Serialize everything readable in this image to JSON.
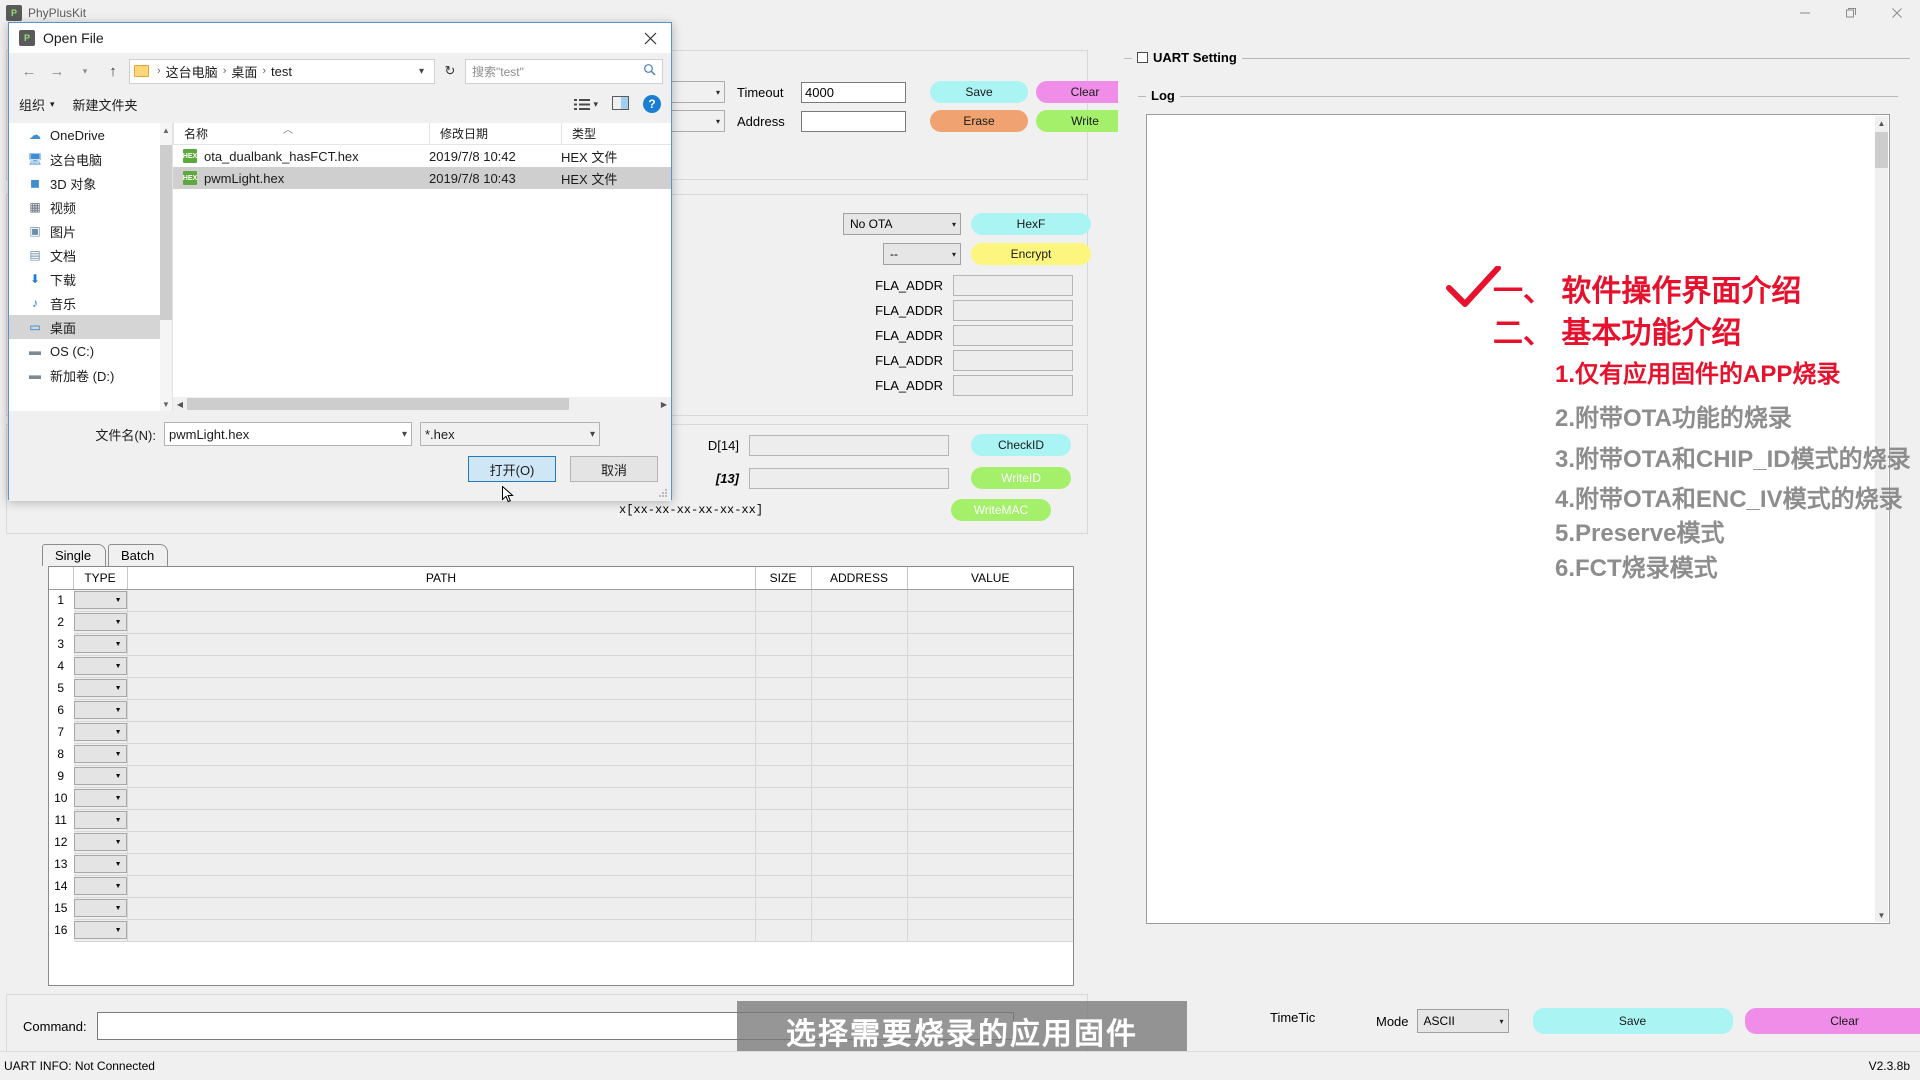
{
  "app": {
    "title": "PhyPlusKit",
    "version": "V2.3.8b",
    "window_controls": {
      "minimize": "minimize-icon",
      "maximize": "maximize-icon",
      "close": "close-icon"
    }
  },
  "config": {
    "timeout_label": "Timeout",
    "timeout_value": "4000",
    "address_label": "Address",
    "address_value": "",
    "buttons": {
      "save": "Save",
      "clear": "Clear",
      "erase": "Erase",
      "write": "Write"
    },
    "colors": {
      "save": "#aaf4f4",
      "clear": "#ef8de8",
      "erase": "#f0a271",
      "write": "#a4f06b"
    }
  },
  "ota": {
    "mode_value": "No OTA",
    "sub_value": "--",
    "hexf_label": "HexF",
    "encrypt_label": "Encrypt",
    "fla_label": "FLA_ADDR",
    "fla_rows": [
      "",
      "",
      "",
      "",
      ""
    ],
    "colors": {
      "hexf": "#aaf4f4",
      "encrypt": "#fcf67e"
    }
  },
  "idmac": {
    "chipid_label": "D[14]",
    "chipid_value": "",
    "mac_label": "[13]",
    "mac_value": "",
    "mac_hint": "x[xx-xx-xx-xx-xx-xx]",
    "checkid_label": "CheckID",
    "writeid_label": "WriteID",
    "writemac_label": "WriteMAC",
    "colors": {
      "checkid": "#aaf4f4",
      "writeid": "#a4f06b",
      "writemac": "#a4f06b"
    }
  },
  "tabs": [
    {
      "label": "Single",
      "active": true
    },
    {
      "label": "Batch",
      "active": false
    }
  ],
  "table": {
    "columns": [
      "",
      "TYPE",
      "PATH",
      "SIZE",
      "ADDRESS",
      "VALUE"
    ],
    "rows": [
      {
        "n": "1",
        "type": "",
        "path": "",
        "size": "",
        "address": "",
        "value": ""
      },
      {
        "n": "2",
        "type": "",
        "path": "",
        "size": "",
        "address": "",
        "value": ""
      },
      {
        "n": "3",
        "type": "",
        "path": "",
        "size": "",
        "address": "",
        "value": ""
      },
      {
        "n": "4",
        "type": "",
        "path": "",
        "size": "",
        "address": "",
        "value": ""
      },
      {
        "n": "5",
        "type": "",
        "path": "",
        "size": "",
        "address": "",
        "value": ""
      },
      {
        "n": "6",
        "type": "",
        "path": "",
        "size": "",
        "address": "",
        "value": ""
      },
      {
        "n": "7",
        "type": "",
        "path": "",
        "size": "",
        "address": "",
        "value": ""
      },
      {
        "n": "8",
        "type": "",
        "path": "",
        "size": "",
        "address": "",
        "value": ""
      },
      {
        "n": "9",
        "type": "",
        "path": "",
        "size": "",
        "address": "",
        "value": ""
      },
      {
        "n": "10",
        "type": "",
        "path": "",
        "size": "",
        "address": "",
        "value": ""
      },
      {
        "n": "11",
        "type": "",
        "path": "",
        "size": "",
        "address": "",
        "value": ""
      },
      {
        "n": "12",
        "type": "",
        "path": "",
        "size": "",
        "address": "",
        "value": ""
      },
      {
        "n": "13",
        "type": "",
        "path": "",
        "size": "",
        "address": "",
        "value": ""
      },
      {
        "n": "14",
        "type": "",
        "path": "",
        "size": "",
        "address": "",
        "value": ""
      },
      {
        "n": "15",
        "type": "",
        "path": "",
        "size": "",
        "address": "",
        "value": ""
      },
      {
        "n": "16",
        "type": "",
        "path": "",
        "size": "",
        "address": "",
        "value": ""
      }
    ]
  },
  "command": {
    "label": "Command:",
    "value": "",
    "timetic_label": "TimeTic",
    "mode_label": "Mode",
    "mode_value": "ASCII",
    "save_label": "Save",
    "clear_label": "Clear",
    "colors": {
      "save": "#aaf4f4",
      "clear": "#ef8de8"
    }
  },
  "right": {
    "uart_setting_label": "UART Setting",
    "log_label": "Log",
    "log_text": ""
  },
  "annotations": {
    "check_mark": "check-icon",
    "items": [
      {
        "text": "一、 软件操作界面介绍",
        "color": "red",
        "size": 30,
        "bold": true
      },
      {
        "text": "二、 基本功能介绍",
        "color": "red",
        "size": 30,
        "bold": true
      },
      {
        "text": "1.仅有应用固件的APP烧录",
        "color": "red",
        "size": 24,
        "bold": true
      },
      {
        "text": "2.附带OTA功能的烧录",
        "color": "gray",
        "size": 24,
        "bold": true
      },
      {
        "text": "3.附带OTA和CHIP_ID模式的烧录",
        "color": "gray",
        "size": 24,
        "bold": true
      },
      {
        "text": "4.附带OTA和ENC_IV模式的烧录",
        "color": "gray",
        "size": 24,
        "bold": true
      },
      {
        "text": "5.Preserve模式",
        "color": "gray",
        "size": 24,
        "bold": true
      },
      {
        "text": "6.FCT烧录模式",
        "color": "gray",
        "size": 24,
        "bold": true
      }
    ],
    "red_hex": "#e8112d",
    "gray_hex": "#8d8d8d"
  },
  "caption": {
    "text": "选择需要烧录的应用固件"
  },
  "statusbar": {
    "uart_info": "UART INFO: Not Connected",
    "version": "V2.3.8b"
  },
  "dialog": {
    "title": "Open File",
    "close_label": "✕",
    "nav": {
      "back": "back-icon",
      "forward": "forward-icon",
      "recent": "recent-icon",
      "up": "up-icon",
      "refresh": "refresh-icon"
    },
    "breadcrumb": [
      "这台电脑",
      "桌面",
      "test"
    ],
    "search_placeholder": "搜索\"test\"",
    "toolbar": {
      "organize": "组织",
      "new_folder": "新建文件夹"
    },
    "places": [
      {
        "label": "OneDrive",
        "icon": "cloud-icon",
        "selected": false
      },
      {
        "label": "这台电脑",
        "icon": "computer-icon",
        "selected": false
      },
      {
        "label": "3D 对象",
        "icon": "cube-icon",
        "selected": false
      },
      {
        "label": "视频",
        "icon": "video-icon",
        "selected": false
      },
      {
        "label": "图片",
        "icon": "picture-icon",
        "selected": false
      },
      {
        "label": "文档",
        "icon": "document-icon",
        "selected": false
      },
      {
        "label": "下载",
        "icon": "download-icon",
        "selected": false
      },
      {
        "label": "音乐",
        "icon": "music-icon",
        "selected": false
      },
      {
        "label": "桌面",
        "icon": "desktop-icon",
        "selected": true
      },
      {
        "label": "OS (C:)",
        "icon": "drive-icon",
        "selected": false
      },
      {
        "label": "新加卷 (D:)",
        "icon": "drive-icon",
        "selected": false
      }
    ],
    "file_columns": [
      "名称",
      "修改日期",
      "类型"
    ],
    "files": [
      {
        "name": "ota_dualbank_hasFCT.hex",
        "date": "2019/7/8 10:42",
        "type": "HEX 文件",
        "selected": false
      },
      {
        "name": "pwmLight.hex",
        "date": "2019/7/8 10:43",
        "type": "HEX 文件",
        "selected": true
      }
    ],
    "filename_label": "文件名(N):",
    "filename_value": "pwmLight.hex",
    "filetype_value": "*.hex",
    "open_button": "打开(O)",
    "cancel_button": "取消"
  }
}
